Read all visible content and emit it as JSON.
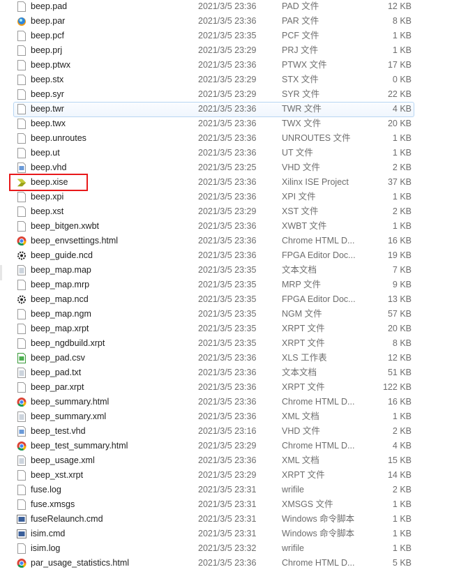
{
  "files": [
    {
      "name": "beep.pad",
      "date": "2021/3/5 23:36",
      "type": "PAD 文件",
      "size": "12 KB",
      "icon": "file-icon"
    },
    {
      "name": "beep.par",
      "date": "2021/3/5 23:36",
      "type": "PAR 文件",
      "size": "8 KB",
      "icon": "par-icon"
    },
    {
      "name": "beep.pcf",
      "date": "2021/3/5 23:35",
      "type": "PCF 文件",
      "size": "1 KB",
      "icon": "file-icon"
    },
    {
      "name": "beep.prj",
      "date": "2021/3/5 23:29",
      "type": "PRJ 文件",
      "size": "1 KB",
      "icon": "file-icon"
    },
    {
      "name": "beep.ptwx",
      "date": "2021/3/5 23:36",
      "type": "PTWX 文件",
      "size": "17 KB",
      "icon": "file-icon"
    },
    {
      "name": "beep.stx",
      "date": "2021/3/5 23:29",
      "type": "STX 文件",
      "size": "0 KB",
      "icon": "file-icon"
    },
    {
      "name": "beep.syr",
      "date": "2021/3/5 23:29",
      "type": "SYR 文件",
      "size": "22 KB",
      "icon": "file-icon"
    },
    {
      "name": "beep.twr",
      "date": "2021/3/5 23:36",
      "type": "TWR 文件",
      "size": "4 KB",
      "icon": "file-icon"
    },
    {
      "name": "beep.twx",
      "date": "2021/3/5 23:36",
      "type": "TWX 文件",
      "size": "20 KB",
      "icon": "file-icon"
    },
    {
      "name": "beep.unroutes",
      "date": "2021/3/5 23:36",
      "type": "UNROUTES 文件",
      "size": "1 KB",
      "icon": "file-icon"
    },
    {
      "name": "beep.ut",
      "date": "2021/3/5 23:36",
      "type": "UT 文件",
      "size": "1 KB",
      "icon": "file-icon"
    },
    {
      "name": "beep.vhd",
      "date": "2021/3/5 23:25",
      "type": "VHD 文件",
      "size": "2 KB",
      "icon": "vhd-icon"
    },
    {
      "name": "beep.xise",
      "date": "2021/3/5 23:36",
      "type": "Xilinx ISE Project",
      "size": "37 KB",
      "icon": "xise-icon"
    },
    {
      "name": "beep.xpi",
      "date": "2021/3/5 23:36",
      "type": "XPI 文件",
      "size": "1 KB",
      "icon": "file-icon"
    },
    {
      "name": "beep.xst",
      "date": "2021/3/5 23:29",
      "type": "XST 文件",
      "size": "2 KB",
      "icon": "file-icon"
    },
    {
      "name": "beep_bitgen.xwbt",
      "date": "2021/3/5 23:36",
      "type": "XWBT 文件",
      "size": "1 KB",
      "icon": "file-icon"
    },
    {
      "name": "beep_envsettings.html",
      "date": "2021/3/5 23:36",
      "type": "Chrome HTML D...",
      "size": "16 KB",
      "icon": "chrome-icon"
    },
    {
      "name": "beep_guide.ncd",
      "date": "2021/3/5 23:36",
      "type": "FPGA Editor Doc...",
      "size": "19 KB",
      "icon": "ncd-icon"
    },
    {
      "name": "beep_map.map",
      "date": "2021/3/5 23:35",
      "type": "文本文档",
      "size": "7 KB",
      "icon": "text-icon"
    },
    {
      "name": "beep_map.mrp",
      "date": "2021/3/5 23:35",
      "type": "MRP 文件",
      "size": "9 KB",
      "icon": "file-icon"
    },
    {
      "name": "beep_map.ncd",
      "date": "2021/3/5 23:35",
      "type": "FPGA Editor Doc...",
      "size": "13 KB",
      "icon": "ncd-icon"
    },
    {
      "name": "beep_map.ngm",
      "date": "2021/3/5 23:35",
      "type": "NGM 文件",
      "size": "57 KB",
      "icon": "file-icon"
    },
    {
      "name": "beep_map.xrpt",
      "date": "2021/3/5 23:35",
      "type": "XRPT 文件",
      "size": "20 KB",
      "icon": "file-icon"
    },
    {
      "name": "beep_ngdbuild.xrpt",
      "date": "2021/3/5 23:35",
      "type": "XRPT 文件",
      "size": "8 KB",
      "icon": "file-icon"
    },
    {
      "name": "beep_pad.csv",
      "date": "2021/3/5 23:36",
      "type": "XLS 工作表",
      "size": "12 KB",
      "icon": "csv-icon"
    },
    {
      "name": "beep_pad.txt",
      "date": "2021/3/5 23:36",
      "type": "文本文档",
      "size": "51 KB",
      "icon": "text-icon"
    },
    {
      "name": "beep_par.xrpt",
      "date": "2021/3/5 23:36",
      "type": "XRPT 文件",
      "size": "122 KB",
      "icon": "file-icon"
    },
    {
      "name": "beep_summary.html",
      "date": "2021/3/5 23:36",
      "type": "Chrome HTML D...",
      "size": "16 KB",
      "icon": "chrome-icon"
    },
    {
      "name": "beep_summary.xml",
      "date": "2021/3/5 23:36",
      "type": "XML 文档",
      "size": "1 KB",
      "icon": "text-icon"
    },
    {
      "name": "beep_test.vhd",
      "date": "2021/3/5 23:16",
      "type": "VHD 文件",
      "size": "2 KB",
      "icon": "vhd-icon"
    },
    {
      "name": "beep_test_summary.html",
      "date": "2021/3/5 23:29",
      "type": "Chrome HTML D...",
      "size": "4 KB",
      "icon": "chrome-icon"
    },
    {
      "name": "beep_usage.xml",
      "date": "2021/3/5 23:36",
      "type": "XML 文档",
      "size": "15 KB",
      "icon": "text-icon"
    },
    {
      "name": "beep_xst.xrpt",
      "date": "2021/3/5 23:29",
      "type": "XRPT 文件",
      "size": "14 KB",
      "icon": "file-icon"
    },
    {
      "name": "fuse.log",
      "date": "2021/3/5 23:31",
      "type": "wrifile",
      "size": "2 KB",
      "icon": "file-icon"
    },
    {
      "name": "fuse.xmsgs",
      "date": "2021/3/5 23:31",
      "type": "XMSGS 文件",
      "size": "1 KB",
      "icon": "file-icon"
    },
    {
      "name": "fuseRelaunch.cmd",
      "date": "2021/3/5 23:31",
      "type": "Windows 命令脚本",
      "size": "1 KB",
      "icon": "cmd-icon"
    },
    {
      "name": "isim.cmd",
      "date": "2021/3/5 23:31",
      "type": "Windows 命令脚本",
      "size": "1 KB",
      "icon": "cmd-icon"
    },
    {
      "name": "isim.log",
      "date": "2021/3/5 23:32",
      "type": "wrifile",
      "size": "1 KB",
      "icon": "file-icon"
    },
    {
      "name": "par_usage_statistics.html",
      "date": "2021/3/5 23:36",
      "type": "Chrome HTML D...",
      "size": "5 KB",
      "icon": "chrome-icon"
    }
  ],
  "highlight_color": "#e8191a"
}
